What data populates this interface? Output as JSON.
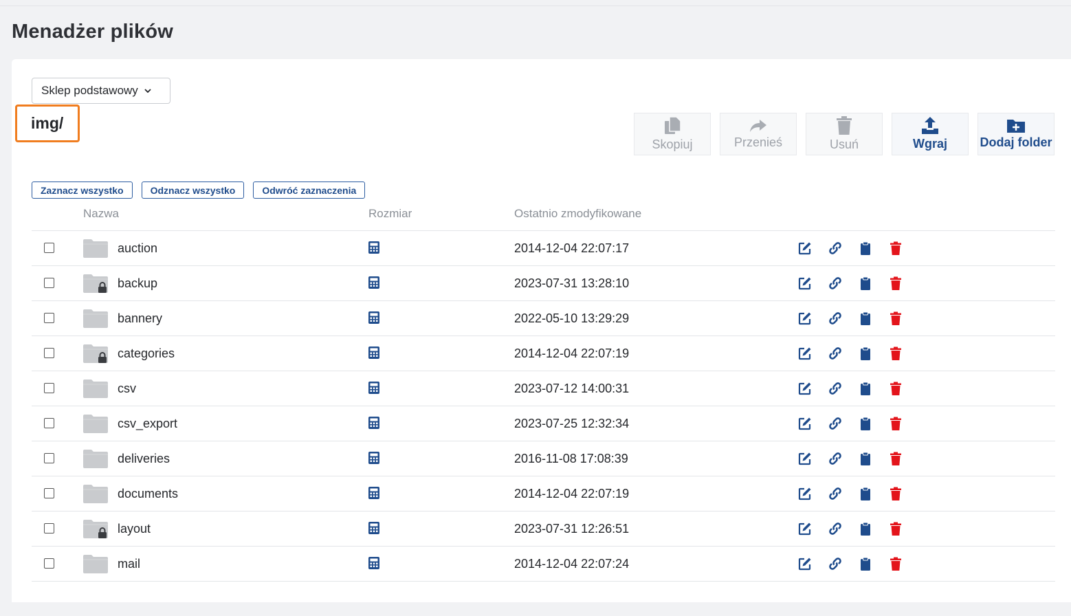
{
  "page": {
    "title": "Menadżer plików"
  },
  "store_select": {
    "value": "Sklep podstawowy"
  },
  "path": "img/",
  "toolbar": {
    "copy": "Skopiuj",
    "move": "Przenieś",
    "delete": "Usuń",
    "upload": "Wgraj",
    "add_folder": "Dodaj folder"
  },
  "selection": {
    "select_all": "Zaznacz wszystko",
    "deselect_all": "Odznacz wszystko",
    "invert": "Odwróć zaznaczenia"
  },
  "columns": {
    "name": "Nazwa",
    "size": "Rozmiar",
    "modified": "Ostatnio zmodyfikowane"
  },
  "colors": {
    "accent": "#1f4c8c",
    "danger": "#e3141b",
    "folder": "#c9cbce",
    "highlight": "#f07d1f"
  },
  "rows": [
    {
      "name": "auction",
      "modified": "2014-12-04 22:07:17",
      "locked": false
    },
    {
      "name": "backup",
      "modified": "2023-07-31 13:28:10",
      "locked": true
    },
    {
      "name": "bannery",
      "modified": "2022-05-10 13:29:29",
      "locked": false
    },
    {
      "name": "categories",
      "modified": "2014-12-04 22:07:19",
      "locked": true
    },
    {
      "name": "csv",
      "modified": "2023-07-12 14:00:31",
      "locked": false
    },
    {
      "name": "csv_export",
      "modified": "2023-07-25 12:32:34",
      "locked": false
    },
    {
      "name": "deliveries",
      "modified": "2016-11-08 17:08:39",
      "locked": false
    },
    {
      "name": "documents",
      "modified": "2014-12-04 22:07:19",
      "locked": false
    },
    {
      "name": "layout",
      "modified": "2023-07-31 12:26:51",
      "locked": true
    },
    {
      "name": "mail",
      "modified": "2014-12-04 22:07:24",
      "locked": false
    }
  ]
}
